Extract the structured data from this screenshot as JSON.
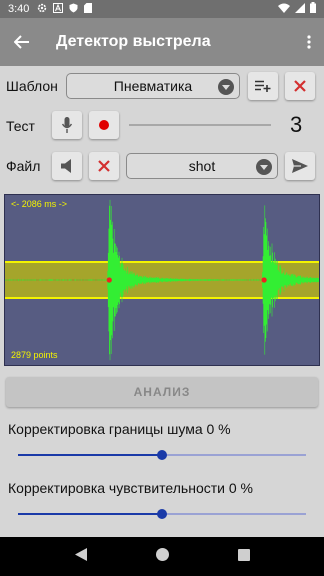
{
  "status_bar": {
    "time": "3:40",
    "icons": [
      "settings-icon",
      "a-icon",
      "shield-icon",
      "sd-card-icon"
    ],
    "right_icons": [
      "wifi-icon",
      "signal-icon",
      "battery-icon"
    ]
  },
  "app_bar": {
    "title": "Детектор выстрела",
    "back_icon": "arrow-back-icon",
    "menu_icon": "more-vert-icon"
  },
  "template_row": {
    "label": "Шаблон",
    "selected": "Пневматика",
    "add_icon": "playlist-add-icon",
    "delete_icon": "close-icon"
  },
  "test_row": {
    "label": "Тест",
    "mic_icon": "mic-icon",
    "record_icon": "record-icon",
    "count": "3"
  },
  "file_row": {
    "label": "Файл",
    "volume_icon": "volume-icon",
    "delete_icon": "close-icon",
    "selected": "shot",
    "send_icon": "send-icon"
  },
  "waveform": {
    "duration_label": "<- 2086 ms ->",
    "points_label": "2879 points",
    "colors": {
      "background": "#575c82",
      "band": "#a5a52b",
      "band_edge": "#f4f400",
      "wave": "#33ee33",
      "marker": "#ee2222"
    },
    "peaks": [
      0.33,
      0.82
    ]
  },
  "analyze_button": {
    "label": "АНАЛИЗ"
  },
  "sliders": [
    {
      "label": "Корректировка границы шума 0 %",
      "value": 0.5
    },
    {
      "label": "Корректировка чувствительности 0 %",
      "value": 0.5
    }
  ],
  "nav_bar": {
    "icons": [
      "back-triangle-icon",
      "home-circle-icon",
      "recents-square-icon"
    ]
  },
  "colors": {
    "accent": "#1a3aa8",
    "delete_red": "#d32f2f",
    "app_bar": "#8a8a8a"
  }
}
